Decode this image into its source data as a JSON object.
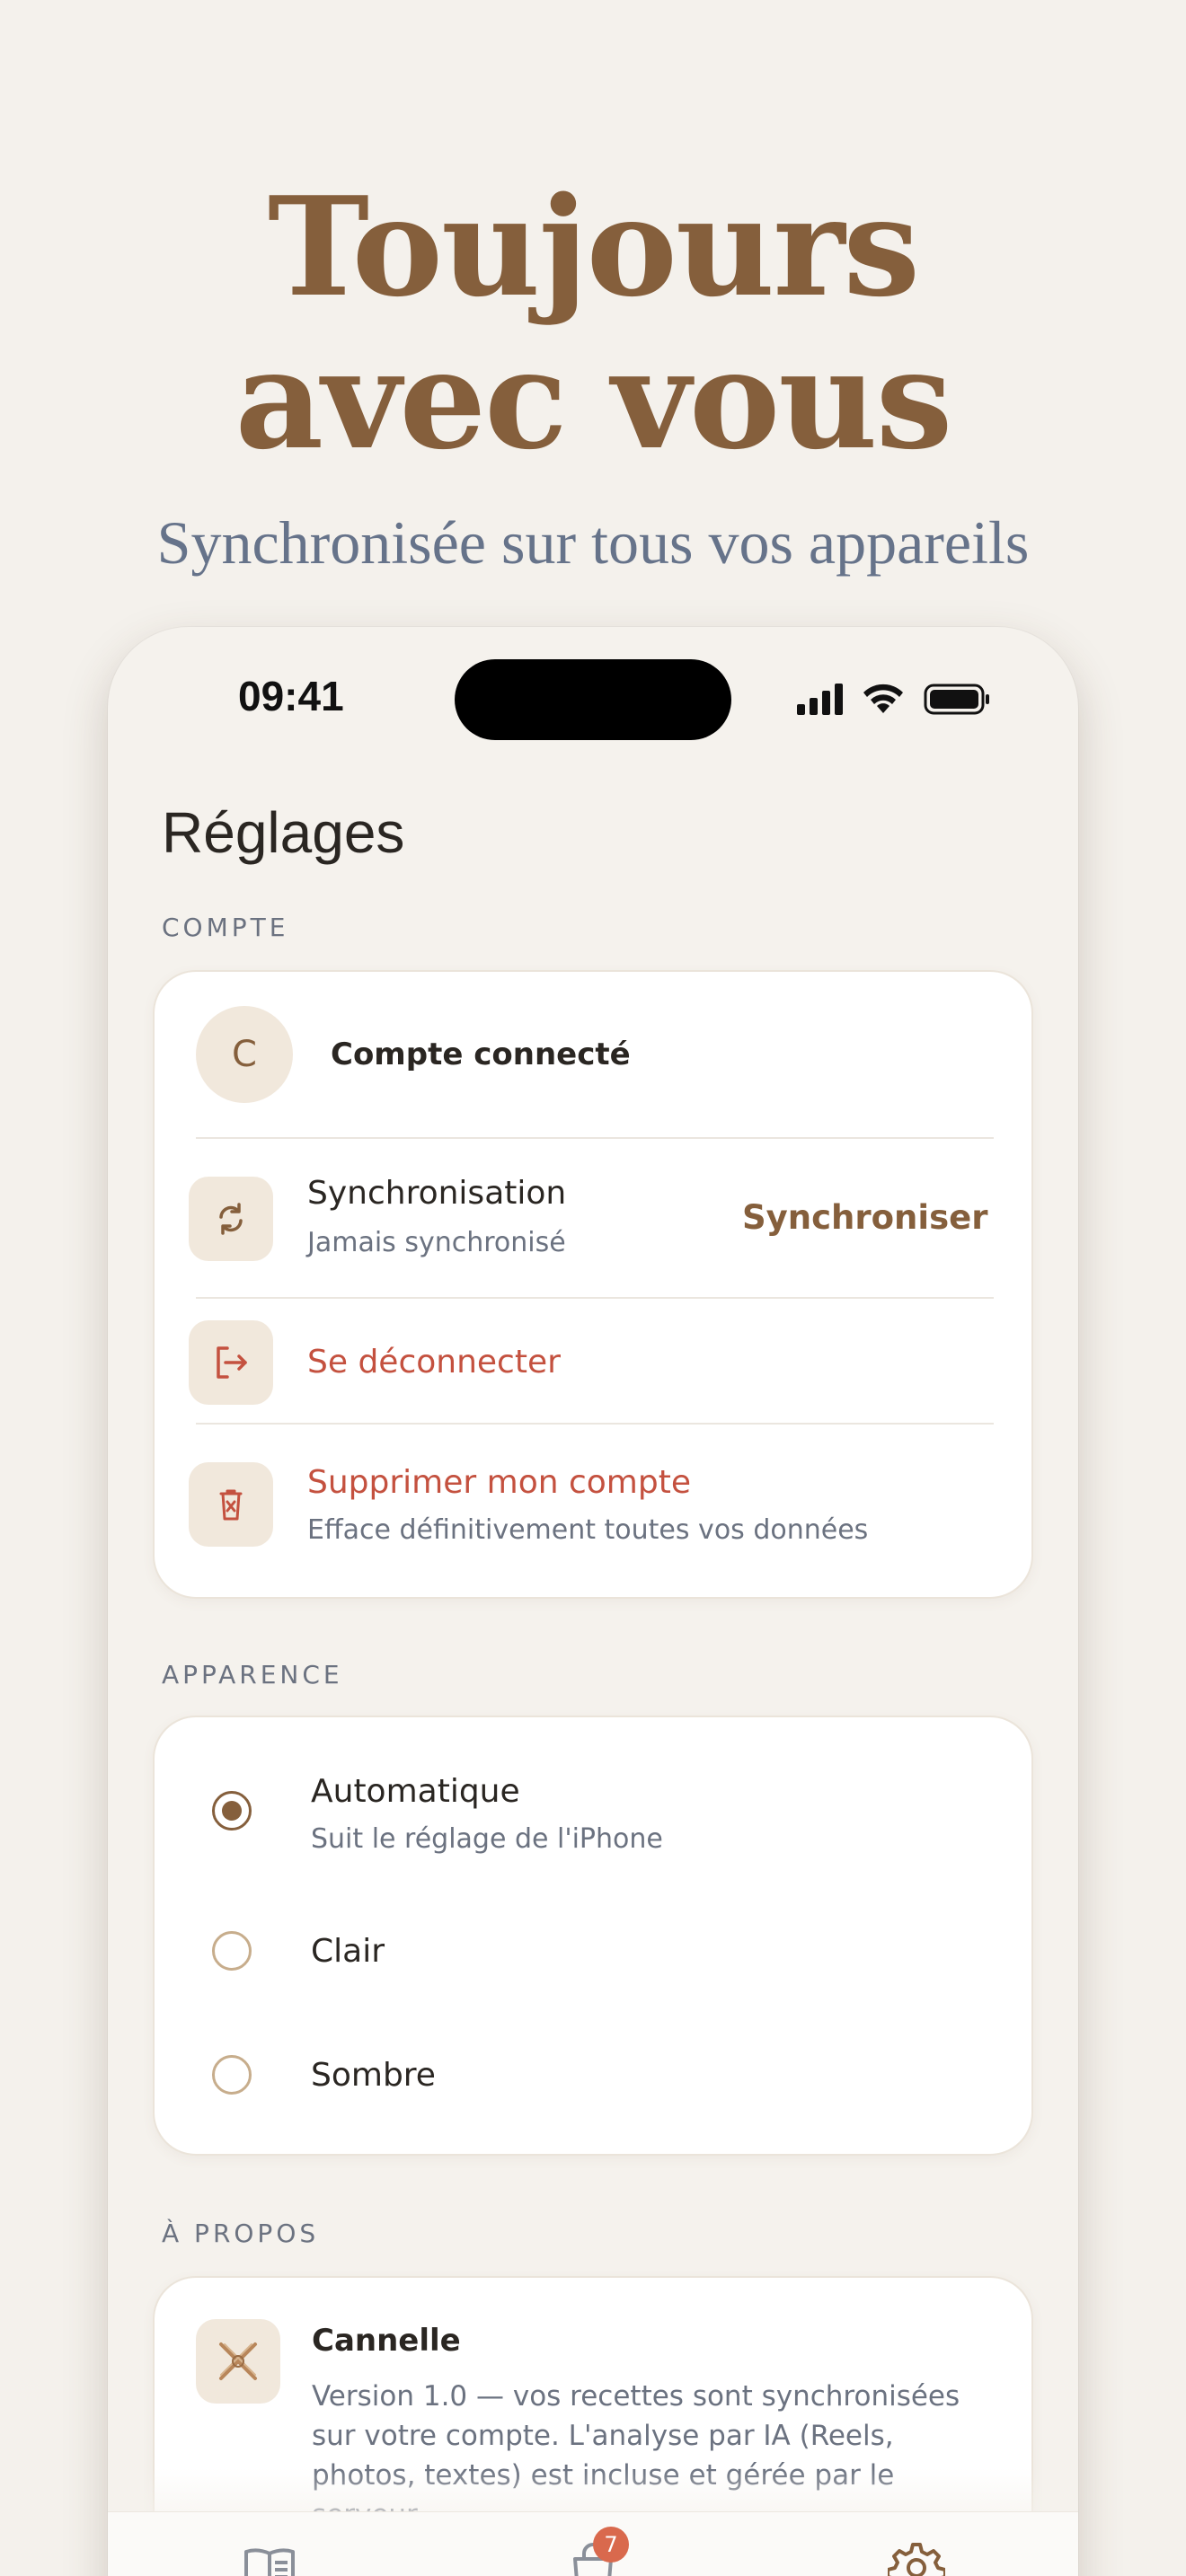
{
  "hero": {
    "title_line1": "Toujours",
    "title_line2": "avec vous",
    "subtitle": "Synchronisée sur tous vos appareils"
  },
  "status_bar": {
    "time": "09:41"
  },
  "page": {
    "title": "Réglages"
  },
  "account": {
    "section_label": "COMPTE",
    "avatar_initial": "C",
    "account_name": "Compte connecté",
    "sync_title": "Synchronisation",
    "sync_status": "Jamais synchronisé",
    "sync_action": "Synchroniser",
    "logout_label": "Se déconnecter",
    "delete_title": "Supprimer mon compte",
    "delete_subtitle": "Efface définitivement toutes vos données"
  },
  "appearance": {
    "section_label": "APPARENCE",
    "options": [
      {
        "label": "Automatique",
        "subtitle": "Suit le réglage de l'iPhone",
        "selected": true
      },
      {
        "label": "Clair",
        "selected": false
      },
      {
        "label": "Sombre",
        "selected": false
      }
    ]
  },
  "about": {
    "section_label": "À PROPOS",
    "app_name": "Cannelle",
    "description": "Version 1.0 — vos recettes sont synchronisées sur votre compte. L'analyse par IA (Reels, photos, textes) est incluse et gérée par le serveur."
  },
  "tab_bar": {
    "items": [
      {
        "icon": "book-icon"
      },
      {
        "icon": "shopping-bag-icon",
        "badge": "7"
      },
      {
        "icon": "gear-icon",
        "active": true
      }
    ]
  },
  "colors": {
    "background": "#f4f1ec",
    "accent": "#855f3c",
    "destructive": "#c4513f",
    "muted_text": "#6b7280",
    "badge": "#d9694d"
  }
}
